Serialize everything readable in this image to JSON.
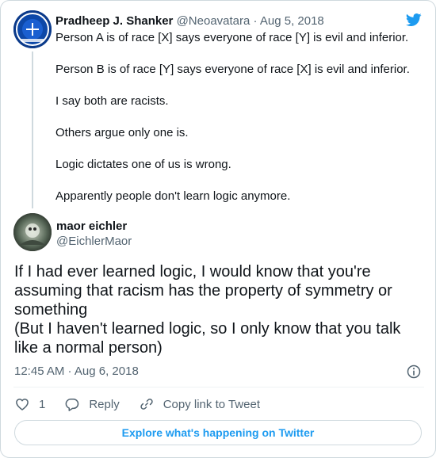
{
  "brand": {
    "logo_icon": "twitter-bird-icon",
    "accent": "#1d9bf0"
  },
  "parent_tweet": {
    "avatar_icon": "avatar-image",
    "name": "Pradheep J. Shanker",
    "handle": "@Neoavatara",
    "separator": " · ",
    "date": "Aug 5, 2018",
    "lines": [
      "Person A is of race [X] says everyone of race [Y] is evil and inferior.",
      "Person B is of race [Y] says everyone of race [X] is evil and inferior.",
      "I say both are racists.",
      "Others argue only one is.",
      "Logic dictates one of us is wrong.",
      "Apparently people don't learn logic anymore."
    ]
  },
  "tweet": {
    "avatar_icon": "avatar-image",
    "name": "maor eichler",
    "handle": "@EichlerMaor",
    "text_lines": [
      "If I had ever learned logic, I would know that you're",
      "assuming that racism has the property of symmetry or",
      "something",
      "(But I haven't learned logic, so I only know that you talk",
      "like a normal person)"
    ],
    "timestamp": "12:45 AM · Aug 6, 2018",
    "info_icon": "info-icon"
  },
  "actions": {
    "like_count": "1",
    "reply_label": "Reply",
    "copy_link_label": "Copy link to Tweet"
  },
  "explore_label": "Explore what's happening on Twitter"
}
